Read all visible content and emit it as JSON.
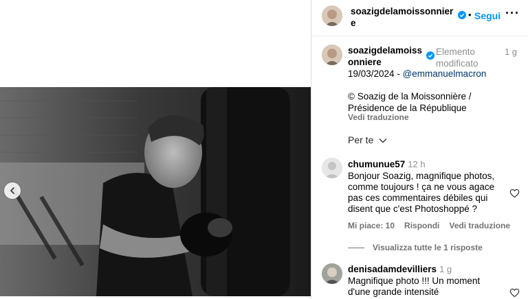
{
  "header": {
    "username": "soazigdelamoissonniere",
    "follow_label": "Segui",
    "dot": "•",
    "more": "···"
  },
  "caption": {
    "username": "soazigdelamoissonniere",
    "edited": "Elemento modificato",
    "time": "1 g",
    "date": "19/03/2024 - ",
    "mention": "@emmanuelmacron",
    "credit": "© Soazig de la Moissonnière / Présidence de la République",
    "see_translation": "Vedi traduzione"
  },
  "sort_label": "Per te",
  "comments": [
    {
      "username": "chumunue57",
      "time": "12 h",
      "text": "Bonjour Soazig, magnifique photos, comme toujours ! ça ne vous agace pas ces commentaires débiles qui disent que c'est Photoshoppé ?",
      "likes": "Mi piace: 10",
      "reply": "Rispondi",
      "translate": "Vedi traduzione",
      "view_replies": "Visualizza tutte le 1 risposte"
    },
    {
      "username": "denisadamdevilliers",
      "time": "1 g",
      "text": "Magnifique photo !!! Un moment d'une grande intensité"
    }
  ],
  "colors": {
    "accent": "#0095f6",
    "muted": "#8e8e8e",
    "mention": "#00376b",
    "verified": "#0095f6"
  },
  "icons": {
    "prev": "chevron-left-icon",
    "verified": "verified-badge-icon",
    "heart": "heart-outline-icon",
    "chevron": "chevron-down-icon"
  }
}
